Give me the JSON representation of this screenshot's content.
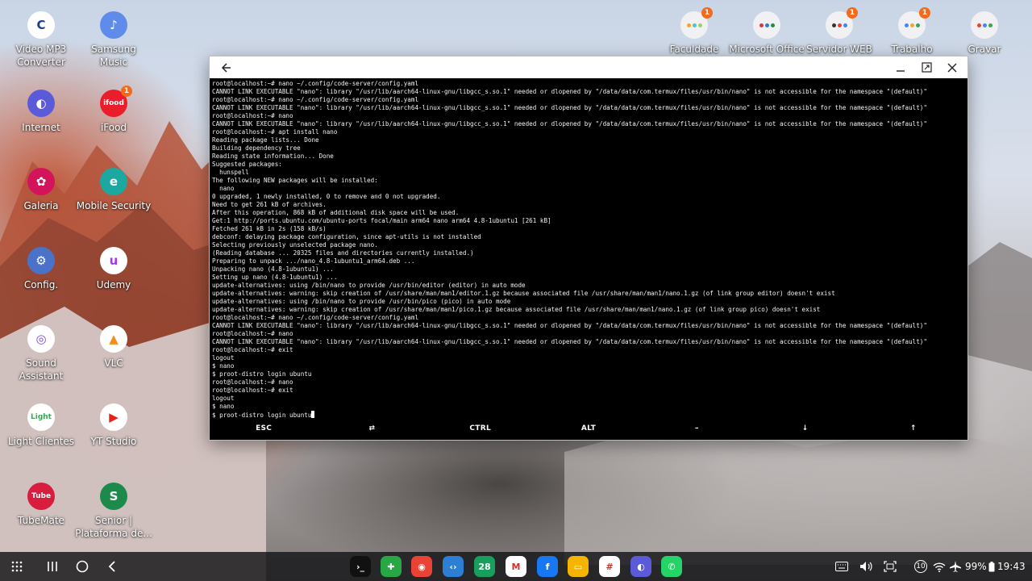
{
  "desktop": {
    "left_icons": [
      {
        "label": "Video MP3\nConverter",
        "glyph": "C",
        "color": "#ffffff",
        "fg": "#1d3d8f",
        "icon": "video-converter-icon"
      },
      {
        "label": "Samsung\nMusic",
        "glyph": "♪",
        "color": "#5f8bea",
        "fg": "#ffffff",
        "icon": "music-note-icon"
      },
      {
        "label": "Internet",
        "glyph": "◐",
        "color": "#5b5bd9",
        "fg": "#ffffff",
        "icon": "internet-browser-icon"
      },
      {
        "label": "iFood",
        "glyph": "ifood",
        "color": "#ea1d2c",
        "fg": "#ffffff",
        "icon": "ifood-icon",
        "badge": "1"
      },
      {
        "label": "Galeria",
        "glyph": "✿",
        "color": "#d3145a",
        "fg": "#ffffff",
        "icon": "gallery-flower-icon"
      },
      {
        "label": "Mobile Security",
        "glyph": "e",
        "color": "#1ba8a0",
        "fg": "#ffffff",
        "icon": "eset-security-icon"
      },
      {
        "label": "Config.",
        "glyph": "⚙",
        "color": "#4b72c9",
        "fg": "#ffffff",
        "icon": "settings-gear-icon"
      },
      {
        "label": "Udemy",
        "glyph": "u",
        "color": "#ffffff",
        "fg": "#a435f0",
        "icon": "udemy-icon"
      },
      {
        "label": "Sound\nAssistant",
        "glyph": "◎",
        "color": "#ffffff",
        "fg": "#7b4bd6",
        "icon": "sound-assistant-icon"
      },
      {
        "label": "VLC",
        "glyph": "▲",
        "color": "#ffffff",
        "fg": "#f28c1a",
        "icon": "vlc-cone-icon"
      },
      {
        "label": "Light Clientes",
        "glyph": "Light",
        "color": "#ffffff",
        "fg": "#3aa656",
        "icon": "light-clientes-icon"
      },
      {
        "label": "YT Studio",
        "glyph": "▶",
        "color": "#ffffff",
        "fg": "#e62117",
        "icon": "yt-studio-icon"
      },
      {
        "label": "TubeMate",
        "glyph": "Tube",
        "color": "#d81d3f",
        "fg": "#ffffff",
        "icon": "tubemate-icon"
      },
      {
        "label": "Senior |\nPlataforma de...",
        "glyph": "S",
        "color": "#1c8a4a",
        "fg": "#ffffff",
        "icon": "senior-platform-icon"
      }
    ],
    "top_folders": [
      {
        "label": "Faculdade",
        "badge": "1",
        "icon": "folder-faculdade-icon"
      },
      {
        "label": "Microsoft Office",
        "badge": "",
        "icon": "folder-microsoft-office-icon"
      },
      {
        "label": "Servidor WEB",
        "badge": "1",
        "icon": "folder-servidor-web-icon"
      },
      {
        "label": "Trabalho",
        "badge": "1",
        "icon": "folder-trabalho-icon"
      },
      {
        "label": "Gravar",
        "badge": "",
        "icon": "gravar-icon"
      }
    ]
  },
  "window": {
    "terminal_lines": [
      "root@localhost:~# nano ~/.config/code-server/config.yaml",
      "CANNOT LINK EXECUTABLE \"nano\": library \"/usr/lib/aarch64-linux-gnu/libgcc_s.so.1\" needed or dlopened by \"/data/data/com.termux/files/usr/bin/nano\" is not accessible for the namespace \"(default)\"",
      "root@localhost:~# nano ~/.config/code-server/config.yaml",
      "CANNOT LINK EXECUTABLE \"nano\": library \"/usr/lib/aarch64-linux-gnu/libgcc_s.so.1\" needed or dlopened by \"/data/data/com.termux/files/usr/bin/nano\" is not accessible for the namespace \"(default)\"",
      "root@localhost:~# nano",
      "CANNOT LINK EXECUTABLE \"nano\": library \"/usr/lib/aarch64-linux-gnu/libgcc_s.so.1\" needed or dlopened by \"/data/data/com.termux/files/usr/bin/nano\" is not accessible for the namespace \"(default)\"",
      "root@localhost:~# apt install nano",
      "Reading package lists... Done",
      "Building dependency tree",
      "Reading state information... Done",
      "Suggested packages:",
      "  hunspell",
      "The following NEW packages will be installed:",
      "  nano",
      "0 upgraded, 1 newly installed, 0 to remove and 0 not upgraded.",
      "Need to get 261 kB of archives.",
      "After this operation, 868 kB of additional disk space will be used.",
      "Get:1 http://ports.ubuntu.com/ubuntu-ports focal/main arm64 nano arm64 4.8-1ubuntu1 [261 kB]",
      "Fetched 261 kB in 2s (158 kB/s)",
      "debconf: delaying package configuration, since apt-utils is not installed",
      "Selecting previously unselected package nano.",
      "(Reading database ... 20325 files and directories currently installed.)",
      "Preparing to unpack .../nano_4.8-1ubuntu1_arm64.deb ...",
      "Unpacking nano (4.8-1ubuntu1) ...",
      "Setting up nano (4.8-1ubuntu1) ...",
      "update-alternatives: using /bin/nano to provide /usr/bin/editor (editor) in auto mode",
      "update-alternatives: warning: skip creation of /usr/share/man/man1/editor.1.gz because associated file /usr/share/man/man1/nano.1.gz (of link group editor) doesn't exist",
      "update-alternatives: using /bin/nano to provide /usr/bin/pico (pico) in auto mode",
      "update-alternatives: warning: skip creation of /usr/share/man/man1/pico.1.gz because associated file /usr/share/man/man1/nano.1.gz (of link group pico) doesn't exist",
      "root@localhost:~# nano ~/.config/code-server/config.yaml",
      "CANNOT LINK EXECUTABLE \"nano\": library \"/usr/lib/aarch64-linux-gnu/libgcc_s.so.1\" needed or dlopened by \"/data/data/com.termux/files/usr/bin/nano\" is not accessible for the namespace \"(default)\"",
      "root@localhost:~# nano",
      "CANNOT LINK EXECUTABLE \"nano\": library \"/usr/lib/aarch64-linux-gnu/libgcc_s.so.1\" needed or dlopened by \"/data/data/com.termux/files/usr/bin/nano\" is not accessible for the namespace \"(default)\"",
      "root@localhost:~# exit",
      "logout",
      "$ nano",
      "$ proot-distro login ubuntu",
      "root@localhost:~# nano",
      "root@localhost:~# exit",
      "logout",
      "$ nano",
      "$ proot-distro login ubuntu"
    ],
    "extra_keys": [
      {
        "label": "ESC",
        "name": "esc-key"
      },
      {
        "label": "⇄",
        "name": "tab-key"
      },
      {
        "label": "CTRL",
        "name": "ctrl-key"
      },
      {
        "label": "ALT",
        "name": "alt-key"
      },
      {
        "label": "–",
        "name": "dash-key"
      },
      {
        "label": "↓",
        "name": "arrow-down-key"
      },
      {
        "label": "↑",
        "name": "arrow-up-key"
      }
    ]
  },
  "taskbar": {
    "dock_apps": [
      {
        "name": "termux-dock-app",
        "glyph": "›_",
        "color": "#111111"
      },
      {
        "name": "sheets-dock-app",
        "glyph": "✚",
        "color": "#27a844"
      },
      {
        "name": "chrome-dock-app",
        "glyph": "◉",
        "color": "#ea4335"
      },
      {
        "name": "code-dock-app",
        "glyph": "‹›",
        "color": "#2d7fd3"
      },
      {
        "name": "calendar-dock-app",
        "glyph": "28",
        "color": "#17a05d"
      },
      {
        "name": "gmail-dock-app",
        "glyph": "M",
        "color": "#ffffff"
      },
      {
        "name": "facebook-dock-app",
        "glyph": "f",
        "color": "#1877f2"
      },
      {
        "name": "files-dock-app",
        "glyph": "▭",
        "color": "#f5b400"
      },
      {
        "name": "slack-dock-app",
        "glyph": "#",
        "color": "#ffffff"
      },
      {
        "name": "internet-dock-app",
        "glyph": "◐",
        "color": "#5b5bd9"
      },
      {
        "name": "whatsapp-dock-app",
        "glyph": "✆",
        "color": "#25d366"
      }
    ],
    "battery": "99%",
    "time": "19:43",
    "notif_count": "10"
  }
}
